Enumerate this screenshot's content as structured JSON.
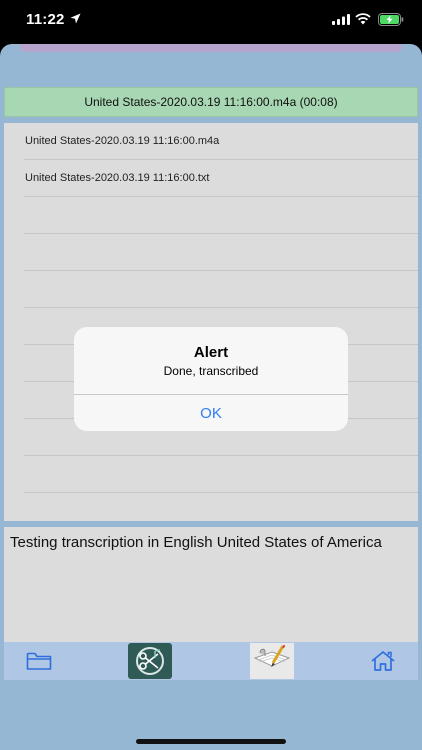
{
  "status_bar": {
    "time": "11:22"
  },
  "recording_title": "United States-2020.03.19 11:16:00.m4a (00:08)",
  "file_list": {
    "items": [
      "United States-2020.03.19 11:16:00.m4a",
      "United States-2020.03.19 11:16:00.txt",
      "",
      "",
      "",
      "",
      "",
      "",
      "",
      "",
      ""
    ]
  },
  "transcript": "Testing transcription in English United States of America",
  "alert": {
    "title": "Alert",
    "message": "Done, transcribed",
    "ok_label": "OK"
  },
  "colors": {
    "background": "#96b7d3",
    "title_bar": "#a8d7b3",
    "list_bg": "#dcdcdc",
    "toolbar": "#afc6e4",
    "accent": "#2f7cf6"
  },
  "icons": {
    "toolbar": [
      "folder-icon",
      "cut-audio-icon",
      "edit-note-icon",
      "home-icon"
    ],
    "status": [
      "location-arrow-icon",
      "signal-icon",
      "wifi-icon",
      "battery-charging-icon"
    ]
  }
}
